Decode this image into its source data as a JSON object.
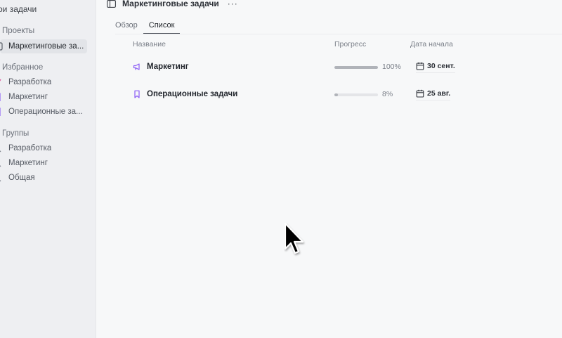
{
  "sidebar": {
    "top_label": "ои задачи",
    "projects_label": "Проекты",
    "project_item": "Маркетинговые за...",
    "favorites_label": "Избранное",
    "favorites": [
      "Разработка",
      "Маркетинг",
      "Операционные за..."
    ],
    "groups_label": "Группы",
    "groups": [
      "Разработка",
      "Маркетинг",
      "Общая"
    ]
  },
  "header": {
    "title": "Маркетинговые задачи",
    "more": "···"
  },
  "tabs": [
    "Обзор",
    "Список"
  ],
  "active_tab": "Список",
  "columns": {
    "name": "Название",
    "progress": "Прогресс",
    "start_date": "Дата начала"
  },
  "rows": [
    {
      "name": "Маркетинг",
      "icon": "megaphone-icon",
      "progress_percent": 100,
      "progress_label": "100%",
      "start_date": "30 сент."
    },
    {
      "name": "Операционные задачи",
      "icon": "bookmark-icon",
      "progress_percent": 8,
      "progress_label": "8%",
      "start_date": "25 авг."
    }
  ],
  "colors": {
    "accent_purple": "#8a5cf6",
    "accent_pink": "#e0559a",
    "progress_fill": "#b0b3b9"
  }
}
